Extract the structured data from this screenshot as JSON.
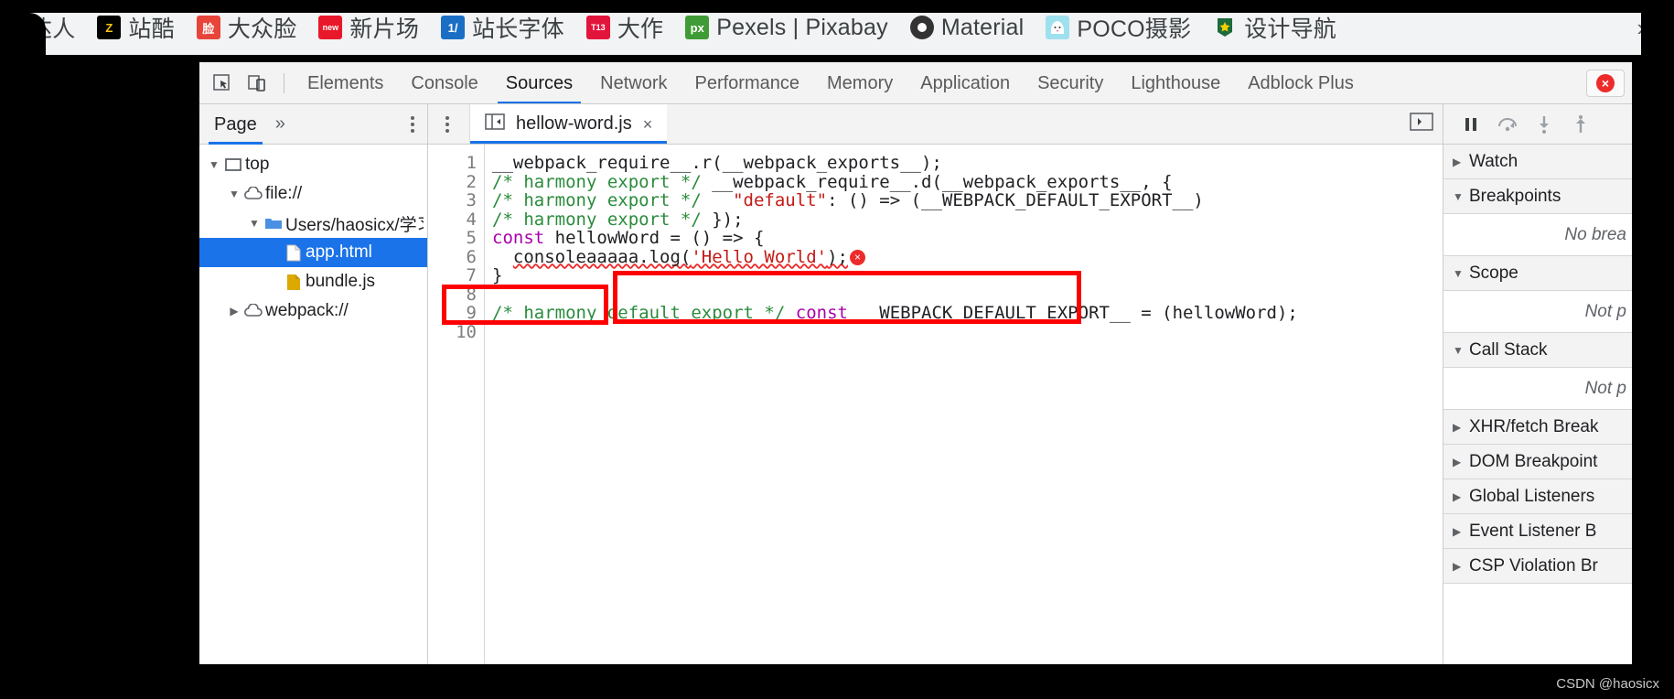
{
  "bookmarks": {
    "items": [
      {
        "label": "达人",
        "icon": "bookmark-icon",
        "icon_text": "",
        "bg": "transparent",
        "fg": "#000000"
      },
      {
        "label": "站酷",
        "icon": "zcool-icon",
        "icon_text": "Z",
        "bg": "#000000",
        "fg": "#f5c518"
      },
      {
        "label": "大众脸",
        "icon": "dazhonglian-icon",
        "icon_text": "脸",
        "bg": "#e8443a",
        "fg": "#ffffff"
      },
      {
        "label": "新片场",
        "icon": "new-icon",
        "icon_text": "new",
        "bg": "#e8182a",
        "fg": "#ffffff"
      },
      {
        "label": "站长字体",
        "icon": "zhanzhang-font-icon",
        "icon_text": "1/",
        "bg": "#1a6fc4",
        "fg": "#ffffff"
      },
      {
        "label": "大作",
        "icon": "dazuo-icon",
        "icon_text": "T13",
        "bg": "#e3143c",
        "fg": "#ffffff"
      },
      {
        "label": "Pexels | Pixabay",
        "icon": "pexels-icon",
        "icon_text": "px",
        "bg": "#3f9b35",
        "fg": "#ffffff"
      },
      {
        "label": "Material",
        "icon": "material-icon",
        "icon_text": "",
        "bg": "#333333",
        "fg": "#ffffff"
      },
      {
        "label": "POCO摄影",
        "icon": "poco-icon",
        "icon_text": "",
        "bg": "#9fe0ef",
        "fg": "#222222"
      },
      {
        "label": "设计导航",
        "icon": "design-nav-icon",
        "icon_text": "★",
        "bg": "#1d6b3a",
        "fg": "#f5d000"
      }
    ],
    "overflow_label": "»"
  },
  "devtools": {
    "toolbar": {
      "inspect_icon": "inspect-element-icon",
      "device_icon": "device-toolbar-icon",
      "tabs": [
        {
          "label": "Elements",
          "active": false
        },
        {
          "label": "Console",
          "active": false
        },
        {
          "label": "Sources",
          "active": true
        },
        {
          "label": "Network",
          "active": false
        },
        {
          "label": "Performance",
          "active": false
        },
        {
          "label": "Memory",
          "active": false
        },
        {
          "label": "Application",
          "active": false
        },
        {
          "label": "Security",
          "active": false
        },
        {
          "label": "Lighthouse",
          "active": false
        },
        {
          "label": "Adblock Plus",
          "active": false
        }
      ],
      "error_badge": {
        "icon": "error-circle-icon",
        "glyph": "×"
      }
    },
    "navigator": {
      "tab_label": "Page",
      "more_tabs_label": "»",
      "menu_icon": "more-options-icon",
      "tree": [
        {
          "label": "top",
          "depth": 0,
          "twisty": "▼",
          "icon": "frame-icon",
          "selected": false
        },
        {
          "label": "file://",
          "depth": 1,
          "twisty": "▼",
          "icon": "cloud-icon",
          "selected": false
        },
        {
          "label": "Users/haosicx/学习",
          "depth": 2,
          "twisty": "▼",
          "icon": "folder-icon",
          "selected": false
        },
        {
          "label": "app.html",
          "depth": 3,
          "twisty": "",
          "icon": "document-icon",
          "selected": true
        },
        {
          "label": "bundle.js",
          "depth": 3,
          "twisty": "",
          "icon": "script-icon",
          "selected": false
        },
        {
          "label": "webpack://",
          "depth": 1,
          "twisty": "▶",
          "icon": "cloud-icon",
          "selected": false
        }
      ]
    },
    "editor": {
      "sidebar_toggle_icon": "show-navigator-icon",
      "tab": {
        "filename": "hellow-word.js",
        "close_glyph": "×"
      },
      "panel_toggle_icon": "show-debugger-icon",
      "line_numbers": [
        "1",
        "2",
        "3",
        "4",
        "5",
        "6",
        "7",
        "8",
        "9",
        "10"
      ],
      "code_lines": [
        {
          "n": 1,
          "text": "__webpack_require__.r(__webpack_exports__);"
        },
        {
          "n": 2,
          "text": "/* harmony export */ __webpack_require__.d(__webpack_exports__, {"
        },
        {
          "n": 3,
          "text": "/* harmony export */   \"default\": () => (__WEBPACK_DEFAULT_EXPORT__)"
        },
        {
          "n": 4,
          "text": "/* harmony export */ });"
        },
        {
          "n": 5,
          "text": "const hellowWord = () => {"
        },
        {
          "n": 6,
          "text": "  consoleaaaaa.log('Hello World');"
        },
        {
          "n": 7,
          "text": "}"
        },
        {
          "n": 8,
          "text": ""
        },
        {
          "n": 9,
          "text": "/* harmony default export */ const __WEBPACK_DEFAULT_EXPORT__ = (hellowWord);"
        },
        {
          "n": 10,
          "text": ""
        }
      ],
      "error_marker": {
        "icon": "inline-error-icon",
        "glyph": "×"
      }
    },
    "debugger": {
      "buttons": [
        {
          "icon": "pause-icon",
          "name": "pause-script-execution"
        },
        {
          "icon": "step-over-icon",
          "name": "step-over-next-function-call"
        },
        {
          "icon": "step-into-icon",
          "name": "step-into-next-function-call"
        },
        {
          "icon": "step-out-icon",
          "name": "step-out-of-current-function"
        }
      ],
      "sections": [
        {
          "label": "Watch",
          "arrow": "▶",
          "expanded": false,
          "empty": null
        },
        {
          "label": "Breakpoints",
          "arrow": "▼",
          "expanded": true,
          "empty": "No brea"
        },
        {
          "label": "Scope",
          "arrow": "▼",
          "expanded": true,
          "empty": "Not p"
        },
        {
          "label": "Call Stack",
          "arrow": "▼",
          "expanded": true,
          "empty": "Not p"
        },
        {
          "label": "XHR/fetch Break",
          "arrow": "▶",
          "expanded": false,
          "empty": null
        },
        {
          "label": "DOM Breakpoint",
          "arrow": "▶",
          "expanded": false,
          "empty": null
        },
        {
          "label": "Global Listeners",
          "arrow": "▶",
          "expanded": false,
          "empty": null
        },
        {
          "label": "Event Listener B",
          "arrow": "▶",
          "expanded": false,
          "empty": null
        },
        {
          "label": "CSP Violation Br",
          "arrow": "▶",
          "expanded": false,
          "empty": null
        }
      ]
    }
  },
  "annotations": {
    "file_highlight": "app.html",
    "code_highlight": "consoleaaaaa.log('Hello World');",
    "box_color": "#ff0000"
  },
  "watermark": "CSDN @haosicx"
}
